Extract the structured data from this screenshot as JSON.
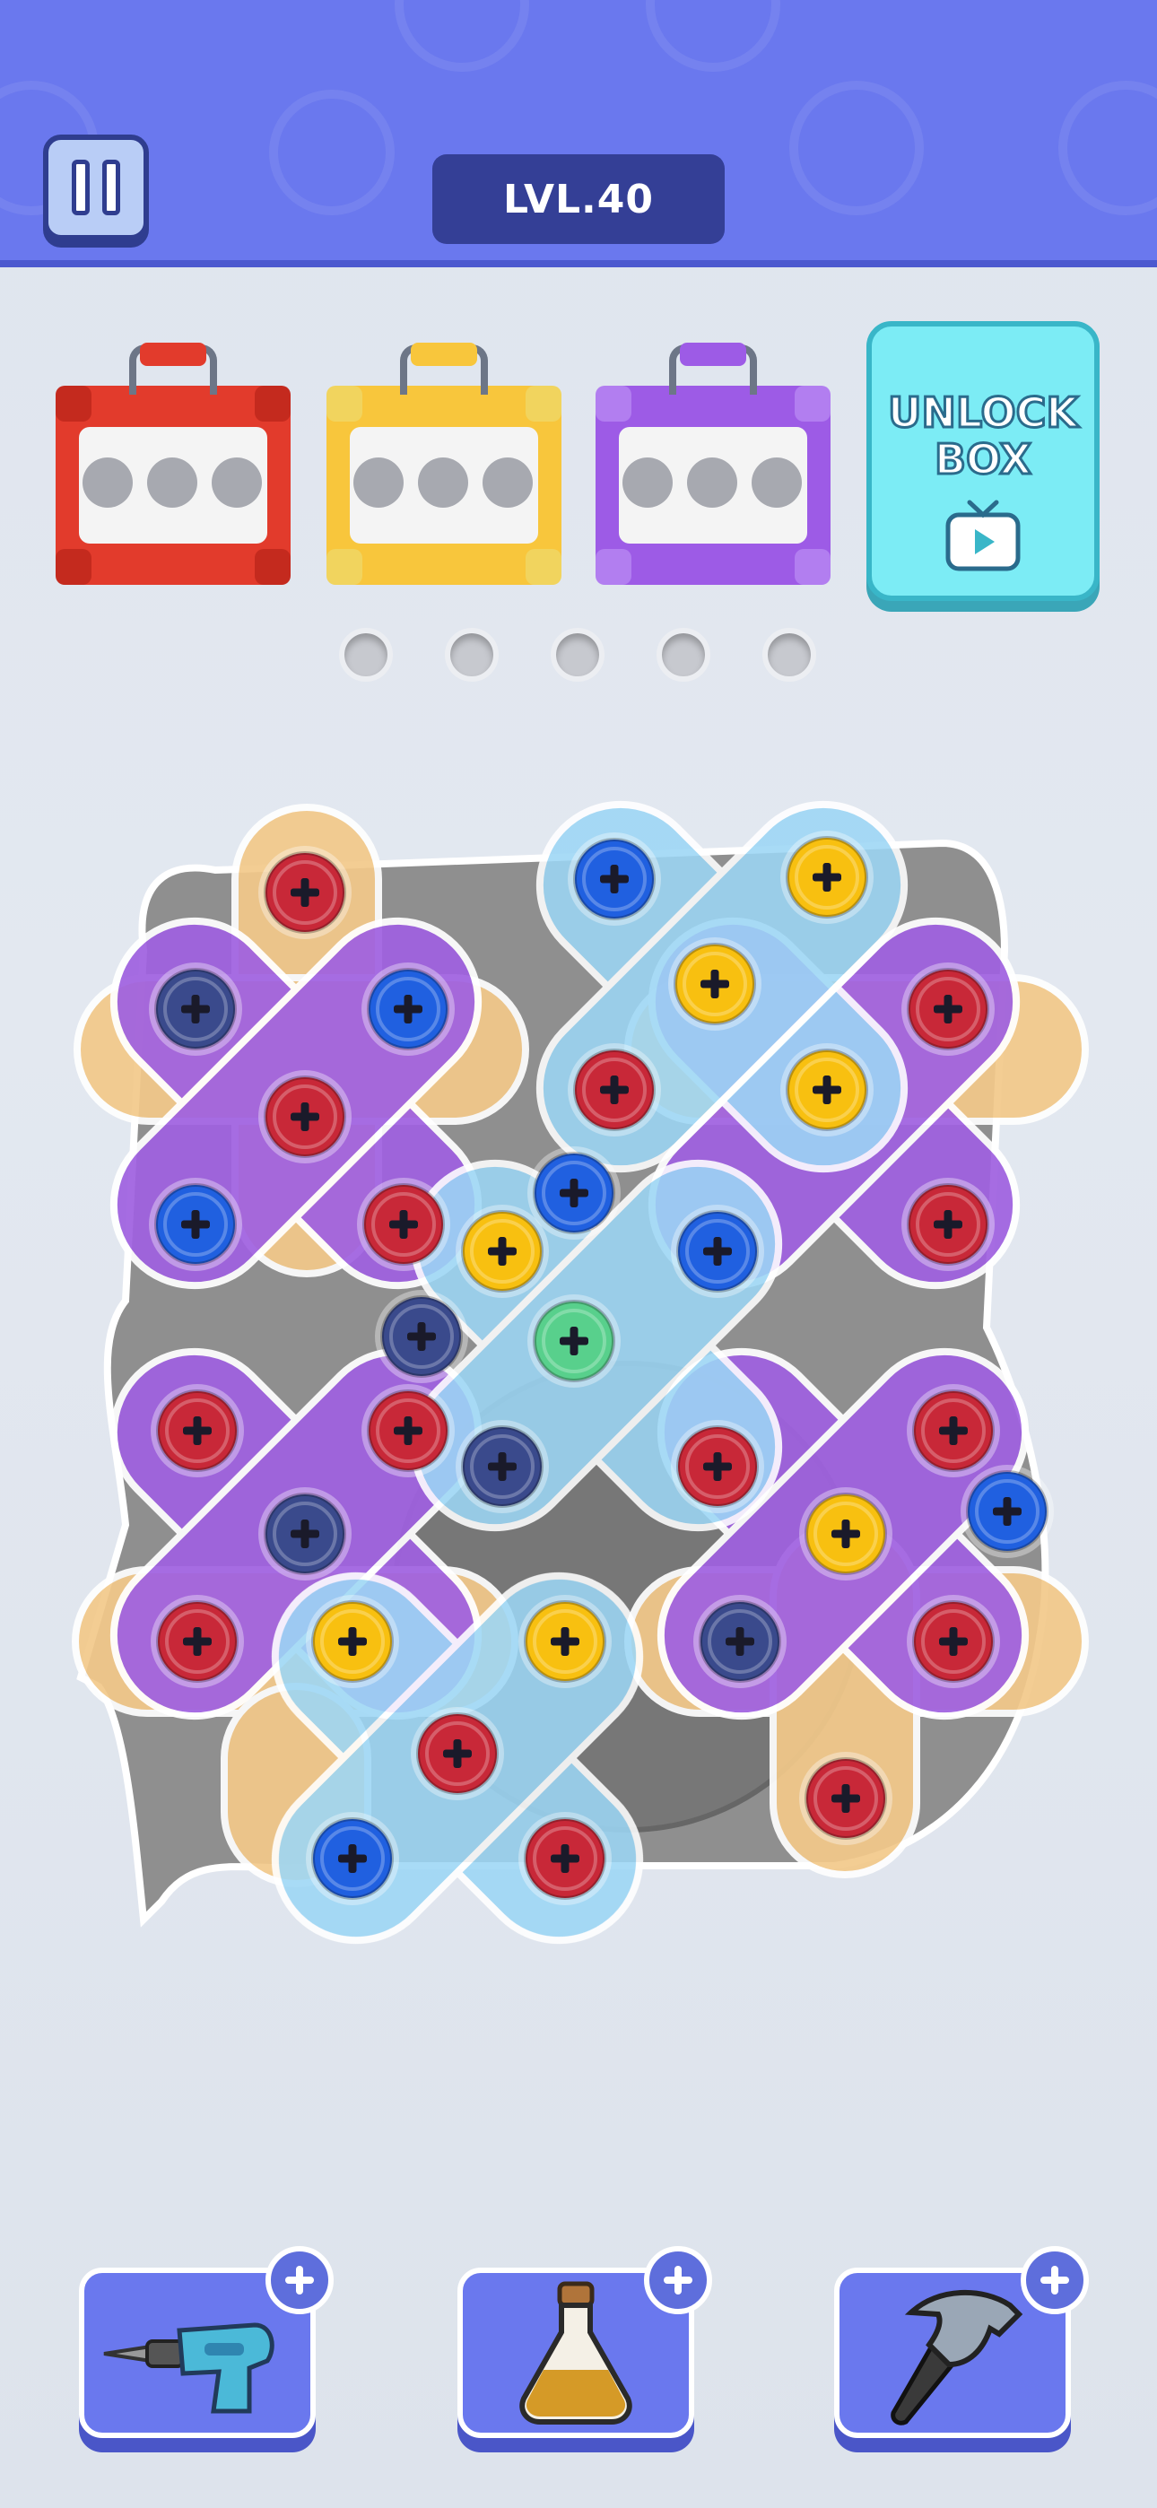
{
  "header": {
    "level_label": "LVL.40",
    "bg_color": "#6a78ee"
  },
  "boxes": [
    {
      "color": "red",
      "hex": "#e23b2c",
      "filled_slots": 0,
      "total_slots": 3
    },
    {
      "color": "yellow",
      "hex": "#f8c63c",
      "filled_slots": 0,
      "total_slots": 3
    },
    {
      "color": "purple",
      "hex": "#9d5be6",
      "filled_slots": 0,
      "total_slots": 3
    }
  ],
  "unlock_box": {
    "label": "UNLOCK\nBOX",
    "icon": "tv-play-icon"
  },
  "holding_holes": {
    "count": 5,
    "filled": 0
  },
  "screw_colors": {
    "red": "#c82838",
    "blue": "#2060e0",
    "yellow": "#f8c010",
    "navy": "#3a4a8c",
    "green": "#58d08c"
  },
  "plate_colors": {
    "purple": "#a061e0",
    "light_blue": "#9dd6f5",
    "peach": "#f3c98a"
  },
  "tools": [
    {
      "name": "drill",
      "icon": "drill-icon"
    },
    {
      "name": "potion",
      "icon": "potion-bottle-icon"
    },
    {
      "name": "hammer",
      "icon": "hammer-icon"
    }
  ]
}
